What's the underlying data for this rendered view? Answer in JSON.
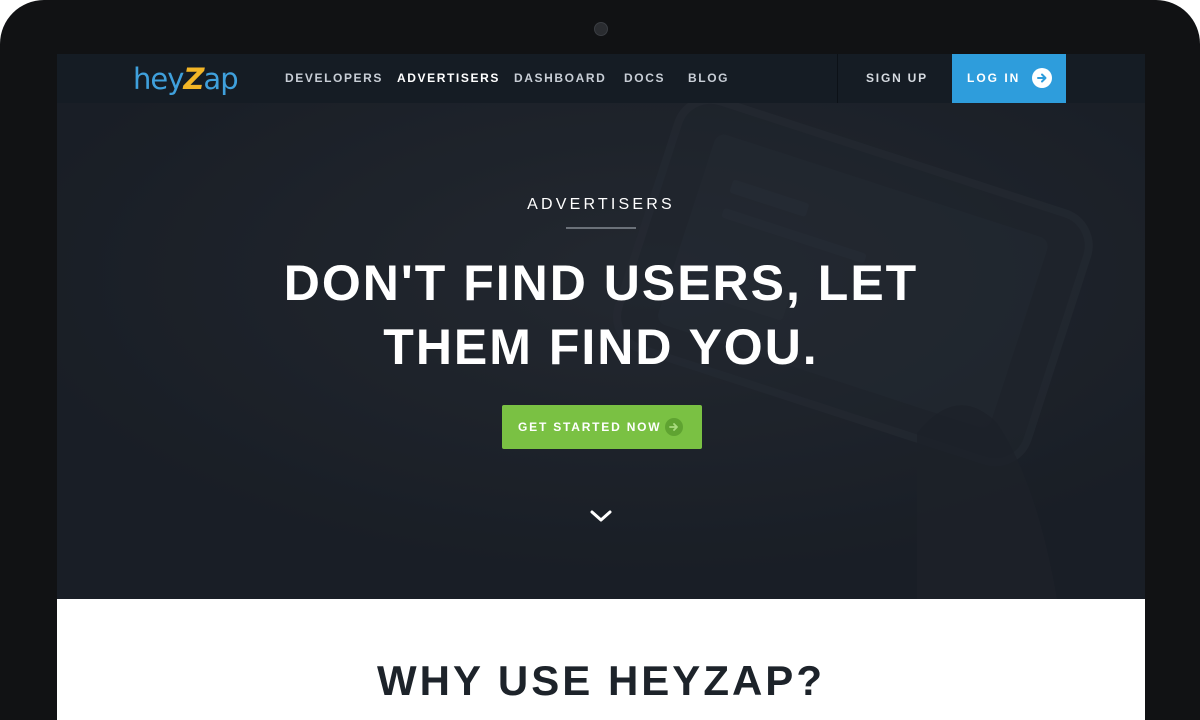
{
  "brand": {
    "logo_prefix": "hey",
    "logo_z": "Z",
    "logo_suffix": "ap",
    "colors": {
      "primary": "#2e9ddc",
      "accent_green": "#7ac143",
      "logo_yellow": "#f2b526",
      "nav_bg": "#151c24"
    }
  },
  "nav": {
    "links": [
      {
        "label": "DEVELOPERS",
        "active": false
      },
      {
        "label": "ADVERTISERS",
        "active": true
      },
      {
        "label": "DASHBOARD",
        "active": false
      },
      {
        "label": "DOCS",
        "active": false
      },
      {
        "label": "BLOG",
        "active": false
      }
    ],
    "sign_up": "SIGN UP",
    "log_in": "LOG IN",
    "log_in_icon": "arrow-circle-right-icon"
  },
  "hero": {
    "eyebrow": "ADVERTISERS",
    "headline_line1": "DON'T FIND USERS, LET",
    "headline_line2": "THEM FIND YOU.",
    "cta_label": "GET STARTED NOW",
    "cta_icon": "arrow-circle-right-icon",
    "scroll_icon": "chevron-down-icon"
  },
  "why": {
    "title": "WHY USE HEYZAP?"
  }
}
